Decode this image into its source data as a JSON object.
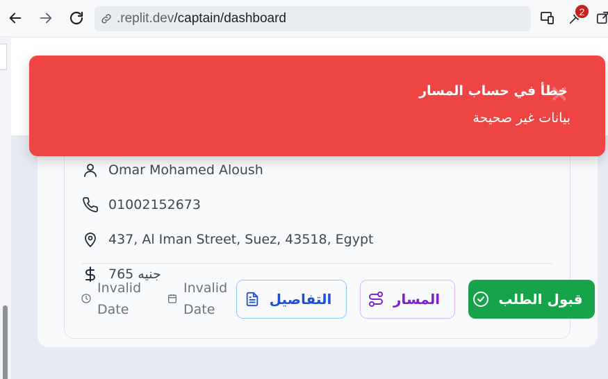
{
  "browser": {
    "url_host": ".replit.dev",
    "url_path": "/captain/dashboard",
    "extensions_badge": "2",
    "icons": [
      "back-arrow-icon",
      "forward-arrow-icon",
      "reload-icon",
      "site-info-icon",
      "devices-icon",
      "extensions-icon",
      "share-icon"
    ]
  },
  "toast": {
    "title": "خطأ في حساب المسار",
    "message": "بيانات غير صحيحة",
    "color": "#ef4444",
    "icon": "close-x-icon"
  },
  "order": {
    "customer_name": "Omar Mohamed Aloush",
    "phone": "01002152673",
    "address": "437, Al Iman Street, Suez, 43518, Egypt",
    "price": "جنيه 765",
    "time_label": "Invalid Date",
    "date_label": "Invalid Date"
  },
  "actions": {
    "details_label": "التفاصيل",
    "route_label": "المسار",
    "accept_label": "قبول الطلب"
  },
  "colors": {
    "details": "#1d4ed8",
    "route": "#7e22ce",
    "accept": "#16a34a"
  }
}
